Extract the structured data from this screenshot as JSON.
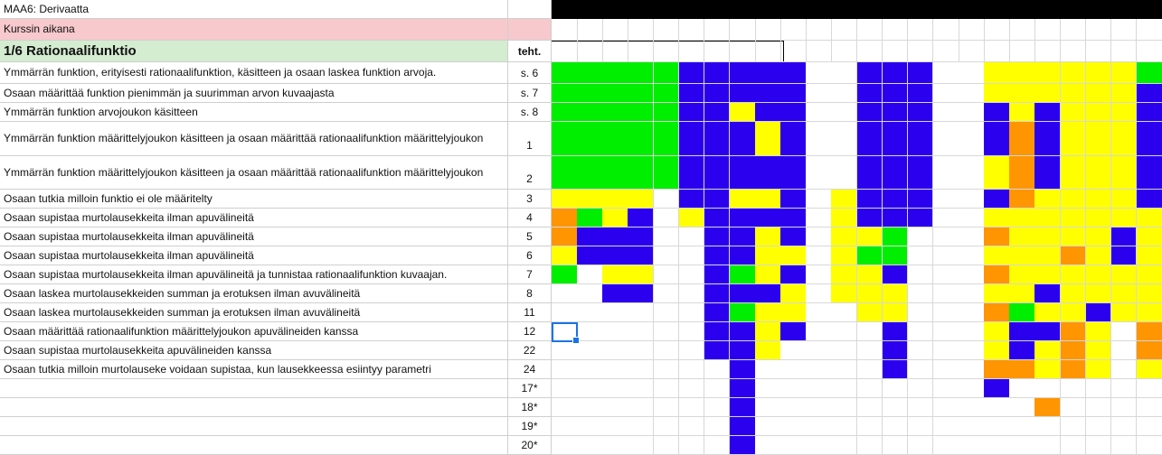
{
  "title": "MAA6: Derivaatta",
  "section": "Kurssin aikana",
  "header": {
    "topic": "1/6 Rationaalifunktio",
    "col_label": "teht."
  },
  "colors": {
    "G": "#00ee00",
    "B": "#2b00ee",
    "Y": "#ffff00",
    "O": "#ff9500",
    "W": "#ffffff"
  },
  "rows": [
    {
      "text": "Ymmärrän funktion, erityisesti rationaalifunktion, käsitteen ja osaan laskea funktion arvoja.",
      "num": "s. 6",
      "cells": "GGGGGBBBBBWWBBBWWYYYYYYG"
    },
    {
      "text": "Osaan määrittää funktion pienimmän ja suurimman arvon kuvaajasta",
      "num": "s. 7",
      "cells": "GGGGGBBBBBWWBBBWWYYYYYYB"
    },
    {
      "text": "Ymmärrän funktion arvojoukon käsitteen",
      "num": "s. 8",
      "cells": "GGGGGBBYBBWWBBBWWBYBYYYB"
    },
    {
      "text": "Ymmärrän funktion määrittelyjoukon käsitteen ja osaan määrittää rationaalifunktion määrittelyjoukon",
      "num": "1",
      "cells": "GGGGGBBBYBWWBBBWWBOBYYYB"
    },
    {
      "text": "Ymmärrän funktion määrittelyjoukon käsitteen ja osaan määrittää rationaalifunktion määrittelyjoukon",
      "num": "2",
      "cells": "GGGGGBBBBBWWBBBWWYOBYYYB"
    },
    {
      "text": "Osaan tutkia milloin funktio ei ole määritelty",
      "num": "3",
      "cells": "YYYYWBBYYBWYBBBWWBOYYYYB"
    },
    {
      "text": "Osaan supistaa murtolausekkeita ilman apuvälineitä",
      "num": "4",
      "cells": "OGYBWYBBBBWYBBBWWYYYYYYY"
    },
    {
      "text": "Osaan supistaa murtolausekkeita ilman apuvälineitä",
      "num": "5",
      "cells": "OBBBWWBBYBWYYGWWWOYYYYBY"
    },
    {
      "text": "Osaan supistaa murtolausekkeita ilman apuvälineitä",
      "num": "6",
      "cells": "YBBBWWBBYYWYGGWWWYYYOYBY"
    },
    {
      "text": "Osaan supistaa murtolausekkeita ilman apuvälineitä ja tunnistaa rationaalifunktion kuvaajan.",
      "num": "7",
      "cells": "GWYYWWBGYBWYYBWWWOYYYYYY"
    },
    {
      "text": "Osaan laskea murtolausekkeiden summan ja erotuksen ilman avuvälineitä",
      "num": "8",
      "cells": "WWBBWWBBBYWYYYWWWYYBYYYY"
    },
    {
      "text": "Osaan laskea murtolausekkeiden summan ja erotuksen ilman avuvälineitä",
      "num": "11",
      "cells": "WWWWWWBGYYWWYYWWWOGYYBYY"
    },
    {
      "text": "Osaan määrittää rationaalifunktion määrittelyjoukon apuvälineiden kanssa",
      "num": "12",
      "cells": "WWWWWWBBYBWWWBWWWYBBOYWO"
    },
    {
      "text": "Osaan supistaa murtolausekkeita apuvälineiden kanssa",
      "num": "22",
      "cells": "WWWWWWBBYWWWWBWWWYBYOYWO"
    },
    {
      "text": "Osaan tutkia milloin murtolauseke voidaan supistaa, kun lausekkeessa esiintyy parametri",
      "num": "24",
      "cells": "WWWWWWWBWWWWWBWWWOOYOYWY"
    },
    {
      "text": "",
      "num": "17*",
      "cells": "WWWWWWWBWWWWWWWWWBWWWWWW"
    },
    {
      "text": "",
      "num": "18*",
      "cells": "WWWWWWWBWWWWWWWWWWWOWWWW"
    },
    {
      "text": "",
      "num": "19*",
      "cells": "WWWWWWWBWWWWWWWWWWWWWWWW"
    },
    {
      "text": "",
      "num": "20*",
      "cells": "WWWWWWWBWWWWWWWWWWWWWWWW"
    }
  ]
}
